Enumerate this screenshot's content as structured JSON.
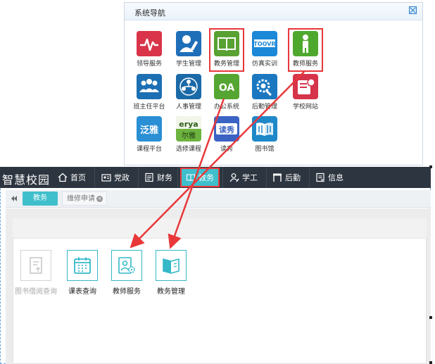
{
  "nav_panel": {
    "title": "系统导航",
    "apps": [
      {
        "label": "领导服务",
        "icon": "pulse-chart-icon",
        "color": "#d9344a"
      },
      {
        "label": "学生管理",
        "icon": "student-edit-icon",
        "color": "#1f6fb8"
      },
      {
        "label": "教务管理",
        "icon": "open-book-icon",
        "color": "#58a132"
      },
      {
        "label": "仿真实训",
        "icon": "simulation-logo-icon",
        "color": "#1b88d8"
      },
      {
        "label": "教师服务",
        "icon": "teacher-figure-icon",
        "color": "#4fa82e"
      },
      {
        "label": "班主任平台",
        "icon": "group-people-icon",
        "color": "#1c6fb3"
      },
      {
        "label": "人事管理",
        "icon": "org-chart-icon",
        "color": "#1b6aa8"
      },
      {
        "label": "办公系统",
        "icon": "oa-text-icon",
        "color": "#55a532"
      },
      {
        "label": "后勤管理",
        "icon": "gear-wrench-icon",
        "color": "#1b78c0"
      },
      {
        "label": "学校网站",
        "icon": "website-badge-icon",
        "color": "#d6344a"
      },
      {
        "label": "课程平台",
        "icon": "course-platform-icon",
        "color": "#2a8fd4"
      },
      {
        "label": "选修课程",
        "icon": "elective-logo-icon",
        "color": "#6db33f"
      },
      {
        "label": "读秀",
        "icon": "duxiu-logo-icon",
        "color": "#3b63c4"
      },
      {
        "label": "图书馆",
        "icon": "library-book-icon",
        "color": "#1e88c8"
      }
    ],
    "apps_logo_text": {
      "oa": "OA",
      "sim": "TOOVR",
      "course": "泛雅",
      "elective_top": "erya",
      "elective_bottom": "尔雅",
      "duxiu": "读秀"
    }
  },
  "topbar": {
    "logo": "智慧校园",
    "menu": [
      {
        "label": "首页",
        "icon": "home-icon"
      },
      {
        "label": "党政",
        "icon": "id-card-icon"
      },
      {
        "label": "财务",
        "icon": "ledger-icon"
      },
      {
        "label": "教务",
        "icon": "book-icon",
        "active": true
      },
      {
        "label": "学工",
        "icon": "user-edit-icon"
      },
      {
        "label": "后勤",
        "icon": "flag-icon"
      },
      {
        "label": "信息",
        "icon": "info-doc-icon"
      }
    ]
  },
  "tabs": {
    "active": "教务",
    "other": "维修申请",
    "close_symbol": "×"
  },
  "services": [
    {
      "label": "图书借阅查询",
      "icon": "book-borrow-icon",
      "disabled": true
    },
    {
      "label": "课表查询",
      "icon": "calendar-icon",
      "disabled": false
    },
    {
      "label": "教师服务",
      "icon": "teacher-settings-icon",
      "disabled": false
    },
    {
      "label": "教务管理",
      "icon": "open-book-icon",
      "disabled": false
    }
  ],
  "colors": {
    "accent": "#3fbfcc",
    "highlight": "#e8383a",
    "topbar": "#2d3540"
  }
}
